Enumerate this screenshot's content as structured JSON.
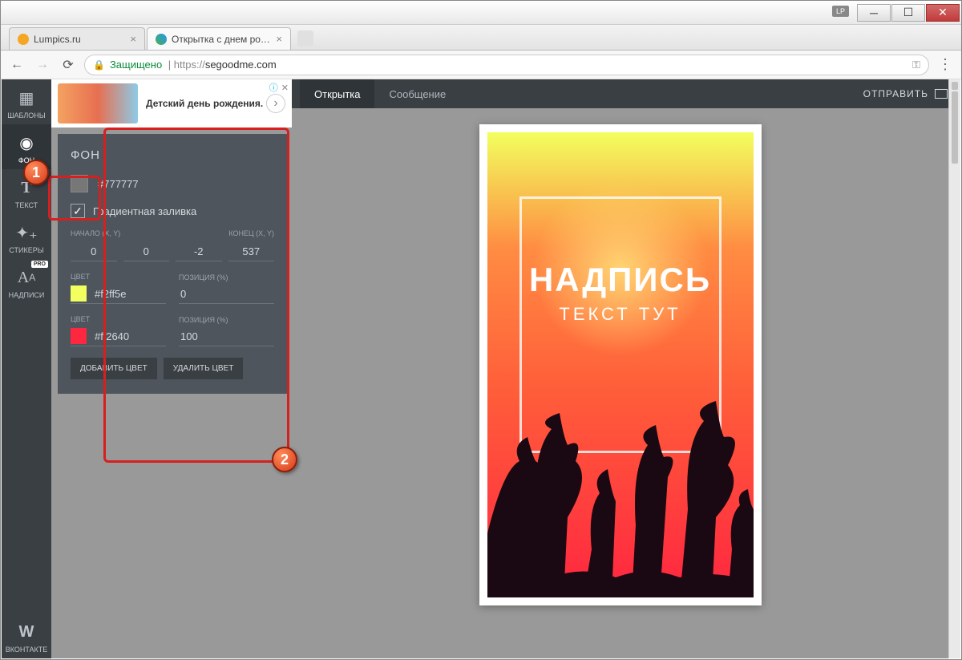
{
  "window": {
    "lp_badge": "LP"
  },
  "browser": {
    "tabs": [
      {
        "title": "Lumpics.ru",
        "active": false
      },
      {
        "title": "Открытка с днем рожде…",
        "active": true
      }
    ],
    "secure_label": "Защищено",
    "url_prefix": "https://",
    "url_host": "segoodme.com"
  },
  "ad": {
    "text": "Детский день рождения."
  },
  "sidebar": {
    "items": [
      {
        "id": "templates",
        "label": "ШАБЛОНЫ"
      },
      {
        "id": "background",
        "label": "ФОН"
      },
      {
        "id": "text",
        "label": "ТЕКСТ"
      },
      {
        "id": "stickers",
        "label": "СТИКЕРЫ"
      },
      {
        "id": "captions",
        "label": "НАДПИСИ",
        "pro": "PRO"
      },
      {
        "id": "vk",
        "label": "ВКОНТАКТЕ"
      }
    ]
  },
  "apptabs": {
    "card": "Открытка",
    "message": "Сообщение",
    "send": "ОТПРАВИТЬ"
  },
  "panel": {
    "title": "ФОН",
    "base_color": "#777777",
    "gradient_label": "Градиентная заливка",
    "gradient_checked": true,
    "start_label": "НАЧАЛО (X, Y)",
    "end_label": "КОНЕЦ (X, Y)",
    "start_x": "0",
    "start_y": "0",
    "end_x": "-2",
    "end_y": "537",
    "color_label": "ЦВЕТ",
    "position_label": "ПОЗИЦИЯ (%)",
    "stops": [
      {
        "color": "#f2ff5e",
        "pos": "0"
      },
      {
        "color": "#ff2640",
        "pos": "100"
      }
    ],
    "add_btn": "ДОБАВИТЬ ЦВЕТ",
    "del_btn": "УДАЛИТЬ ЦВЕТ"
  },
  "card": {
    "line1": "НАДПИСЬ",
    "line2": "ТЕКСТ ТУТ"
  },
  "markers": {
    "m1": "1",
    "m2": "2"
  }
}
